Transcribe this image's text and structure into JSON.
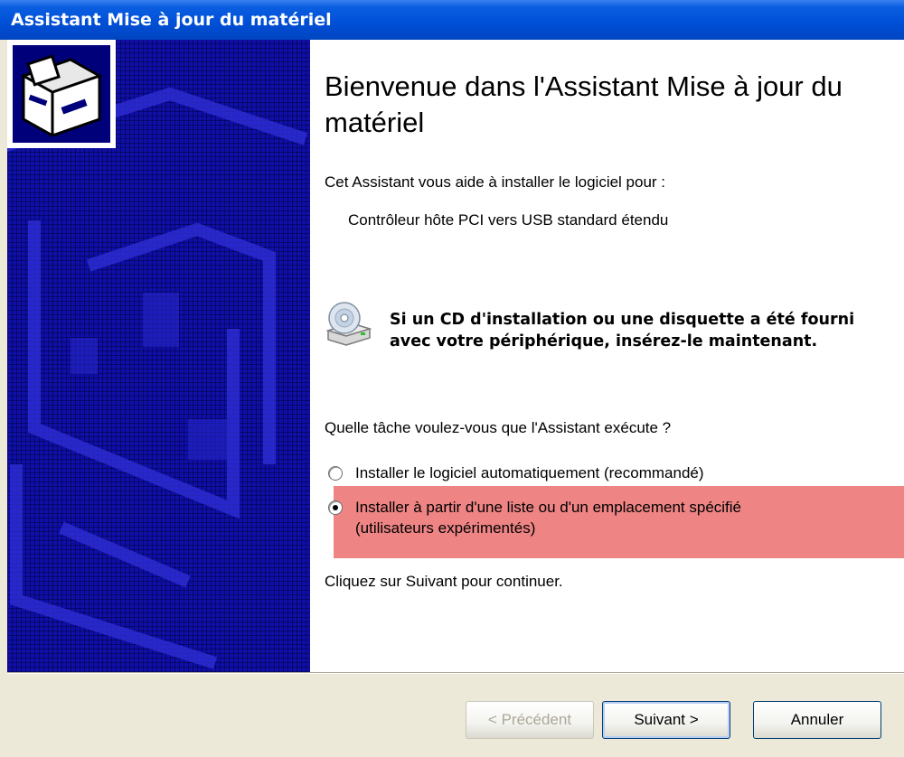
{
  "window": {
    "title": "Assistant Mise à jour du matériel"
  },
  "main": {
    "heading": "Bienvenue dans l'Assistant Mise à jour du matériel",
    "intro": "Cet Assistant vous aide à installer le logiciel pour :",
    "device_name": "Contrôleur hôte PCI vers USB standard étendu",
    "cd_notice": "Si un CD d'installation ou une disquette a été fourni avec votre périphérique, insérez-le maintenant.",
    "question": "Quelle tâche voulez-vous que l'Assistant exécute ?",
    "options": [
      {
        "label": "Installer le logiciel automatiquement (recommandé)",
        "selected": false
      },
      {
        "label_line1": "Installer à partir d'une liste ou d'un emplacement spécifié",
        "label_line2": "(utilisateurs expérimentés)",
        "selected": true
      }
    ],
    "continue_hint": "Cliquez sur Suivant pour continuer."
  },
  "buttons": {
    "back": "< Précédent",
    "next": "Suivant >",
    "cancel": "Annuler"
  },
  "icons": {
    "hardware": "hardware-wizard-icon",
    "cd": "cd-drive-icon"
  },
  "colors": {
    "titlebar": "#0050d8",
    "sidebar": "#0f0fa8",
    "highlight": "#ee8484",
    "dialog_bg": "#ece9d8"
  }
}
